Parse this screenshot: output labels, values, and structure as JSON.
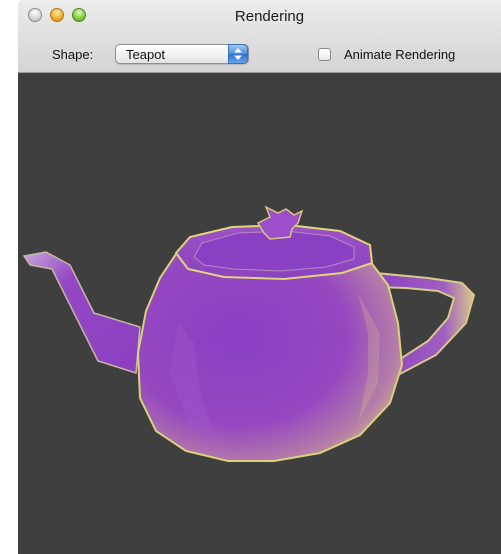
{
  "window": {
    "title": "Rendering",
    "controls": [
      "close-button",
      "minimize-button",
      "zoom-button"
    ]
  },
  "toolbar": {
    "shape_label": "Shape:",
    "shape_value": "Teapot",
    "animate_label": "Animate Rendering",
    "animate_checked": false
  },
  "viewport": {
    "background": "#3f3f3f",
    "model": "teapot",
    "model_color": "#8a3fc0",
    "highlight_color": "#d8d27a"
  }
}
